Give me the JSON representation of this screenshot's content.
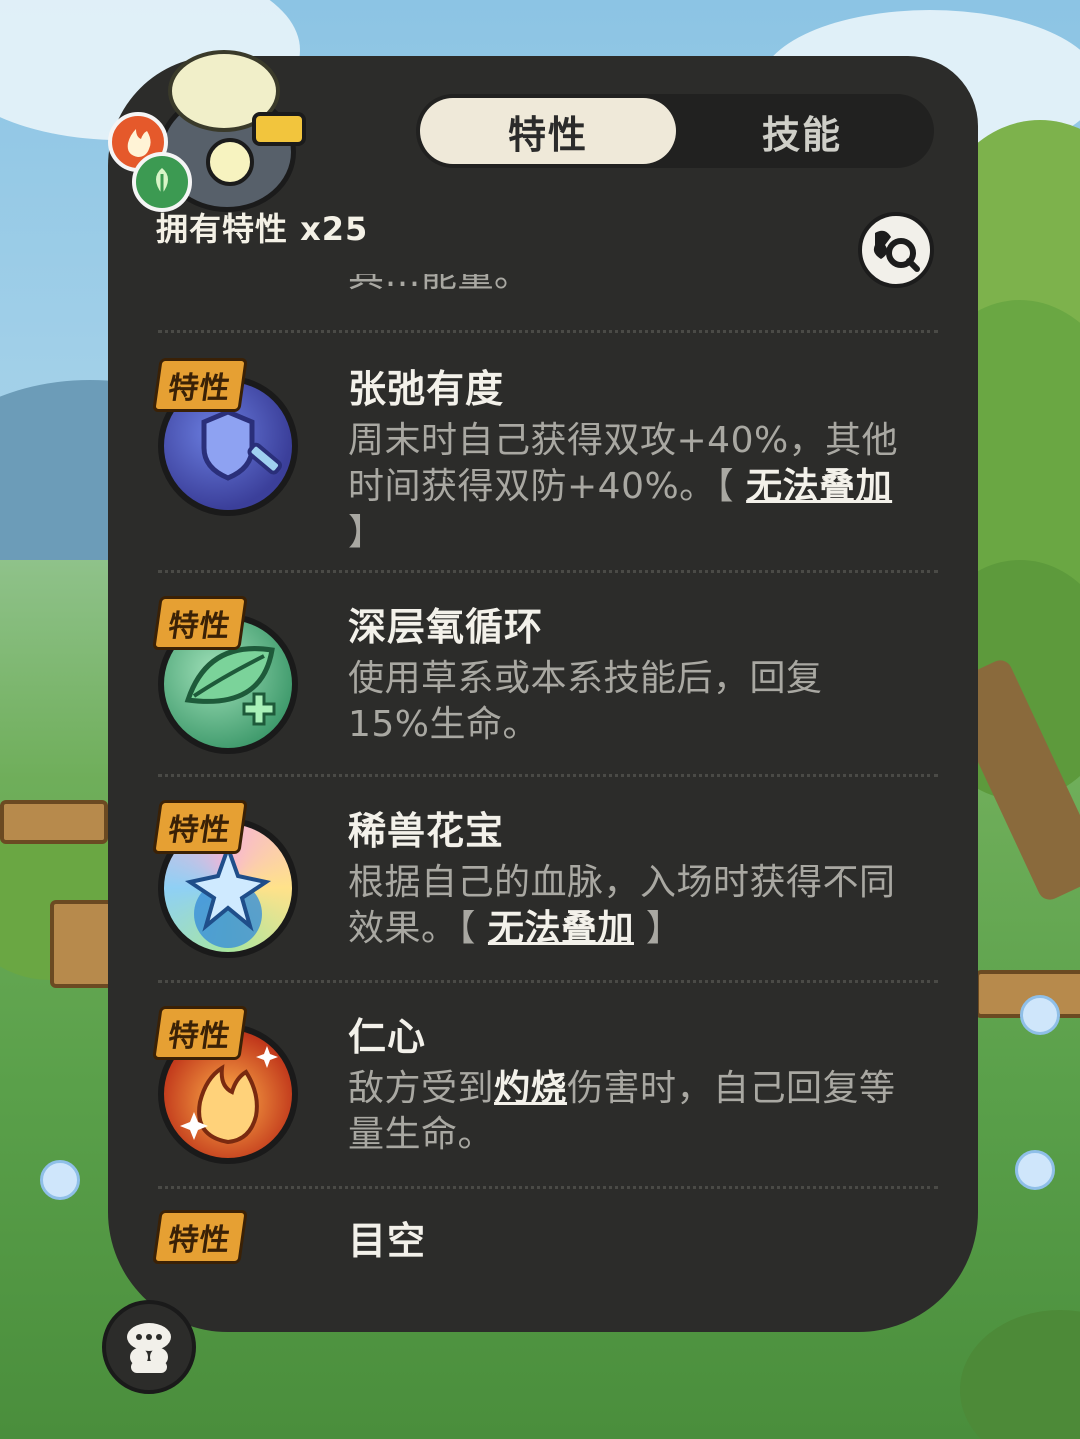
{
  "tabs": {
    "traits_label": "特性",
    "skills_label": "技能"
  },
  "owned_label": "拥有特性 x25",
  "partial_top_desc": "其…能量。",
  "tag_label": "特性",
  "traits": [
    {
      "name": "张弛有度",
      "desc_lines": [
        [
          {
            "t": "周末时自己获得双攻+40%，其他"
          }
        ],
        [
          {
            "t": "时间获得双防+40%。【 "
          },
          {
            "t": "无法叠加",
            "kw": true
          }
        ],
        [
          {
            "t": "】"
          }
        ]
      ],
      "icon": "shield-sword-icon"
    },
    {
      "name": "深层氧循环",
      "desc_lines": [
        [
          {
            "t": "使用草系或本系技能后，回复"
          }
        ],
        [
          {
            "t": "15%生命。"
          }
        ]
      ],
      "icon": "leaf-heal-icon"
    },
    {
      "name": "稀兽花宝",
      "desc_lines": [
        [
          {
            "t": "根据自己的血脉，入场时获得不同"
          }
        ],
        [
          {
            "t": "效果。【 "
          },
          {
            "t": "无法叠加",
            "kw": true
          },
          {
            "t": " 】"
          }
        ]
      ],
      "icon": "star-swirl-icon"
    },
    {
      "name": "仁心",
      "desc_lines": [
        [
          {
            "t": "敌方受到"
          },
          {
            "t": "灼烧",
            "kw": true
          },
          {
            "t": "伤害时，自己回复等"
          }
        ],
        [
          {
            "t": "量生命。"
          }
        ]
      ],
      "icon": "flame-sparkle-icon"
    },
    {
      "name": "目空",
      "desc_lines": [],
      "icon": "partial-icon"
    }
  ],
  "type_badges": [
    "fire-type-icon",
    "grass-type-icon"
  ],
  "colors": {
    "panel": "#2c2c2a",
    "tag": "#e6a033",
    "active_tab": "#efe9d9",
    "desc_text": "#a9a8a2"
  }
}
